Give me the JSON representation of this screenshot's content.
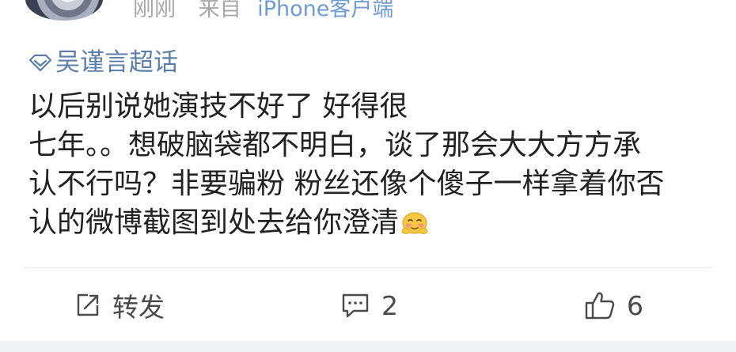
{
  "post": {
    "time": "刚刚",
    "source_label": "来自",
    "source_device": "iPhone客户端",
    "topic": "吴谨言超话",
    "lines": [
      "以后别说她演技不好了 好得很",
      "七年。。想破脑袋都不明白，谈了那会大大方方承",
      "认不行吗？非要骗粉 粉丝还像个傻子一样拿着你否",
      "认的微博截图到处去给你澄清"
    ],
    "emoji": "shy-face-emoji"
  },
  "actions": {
    "repost_label": "转发",
    "comment_count": "2",
    "like_count": "6"
  },
  "icons": {
    "topic": "diamond-icon",
    "repost": "share-edit-icon",
    "comment": "comment-icon",
    "like": "thumbs-up-icon"
  },
  "colors": {
    "topic": "#5b7faa",
    "text": "#222222",
    "meta": "#a7a7a7",
    "device": "#6e9bd1"
  }
}
